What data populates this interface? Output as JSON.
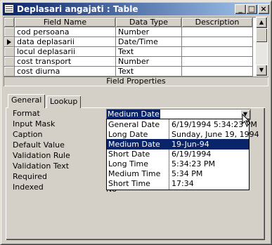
{
  "window": {
    "title": "Deplasari angajati : Table"
  },
  "columns": [
    "Field Name",
    "Data Type",
    "Description"
  ],
  "rows": [
    {
      "name": "cod persoana",
      "type": "Number",
      "desc": ""
    },
    {
      "name": "data deplasarii",
      "type": "Date/Time",
      "desc": ""
    },
    {
      "name": "locul deplasarii",
      "type": "Text",
      "desc": ""
    },
    {
      "name": "cost transport",
      "type": "Number",
      "desc": ""
    },
    {
      "name": "cost diurna",
      "type": "Text",
      "desc": ""
    }
  ],
  "field_properties_label": "Field Properties",
  "tabs": [
    "General",
    "Lookup"
  ],
  "properties": [
    "Format",
    "Input Mask",
    "Caption",
    "Default Value",
    "Validation Rule",
    "Validation Text",
    "Required",
    "Indexed"
  ],
  "format_value": "Medium Date",
  "indexed_partial": "No",
  "dropdown": [
    {
      "name": "General Date",
      "example": "6/19/1994 5:34:23 PM"
    },
    {
      "name": "Long Date",
      "example": "Sunday, June 19, 1994"
    },
    {
      "name": "Medium Date",
      "example": "19-Jun-94"
    },
    {
      "name": "Short Date",
      "example": "6/19/1994"
    },
    {
      "name": "Long Time",
      "example": "5:34:23 PM"
    },
    {
      "name": "Medium Time",
      "example": "5:34 PM"
    },
    {
      "name": "Short Time",
      "example": "17:34"
    }
  ]
}
